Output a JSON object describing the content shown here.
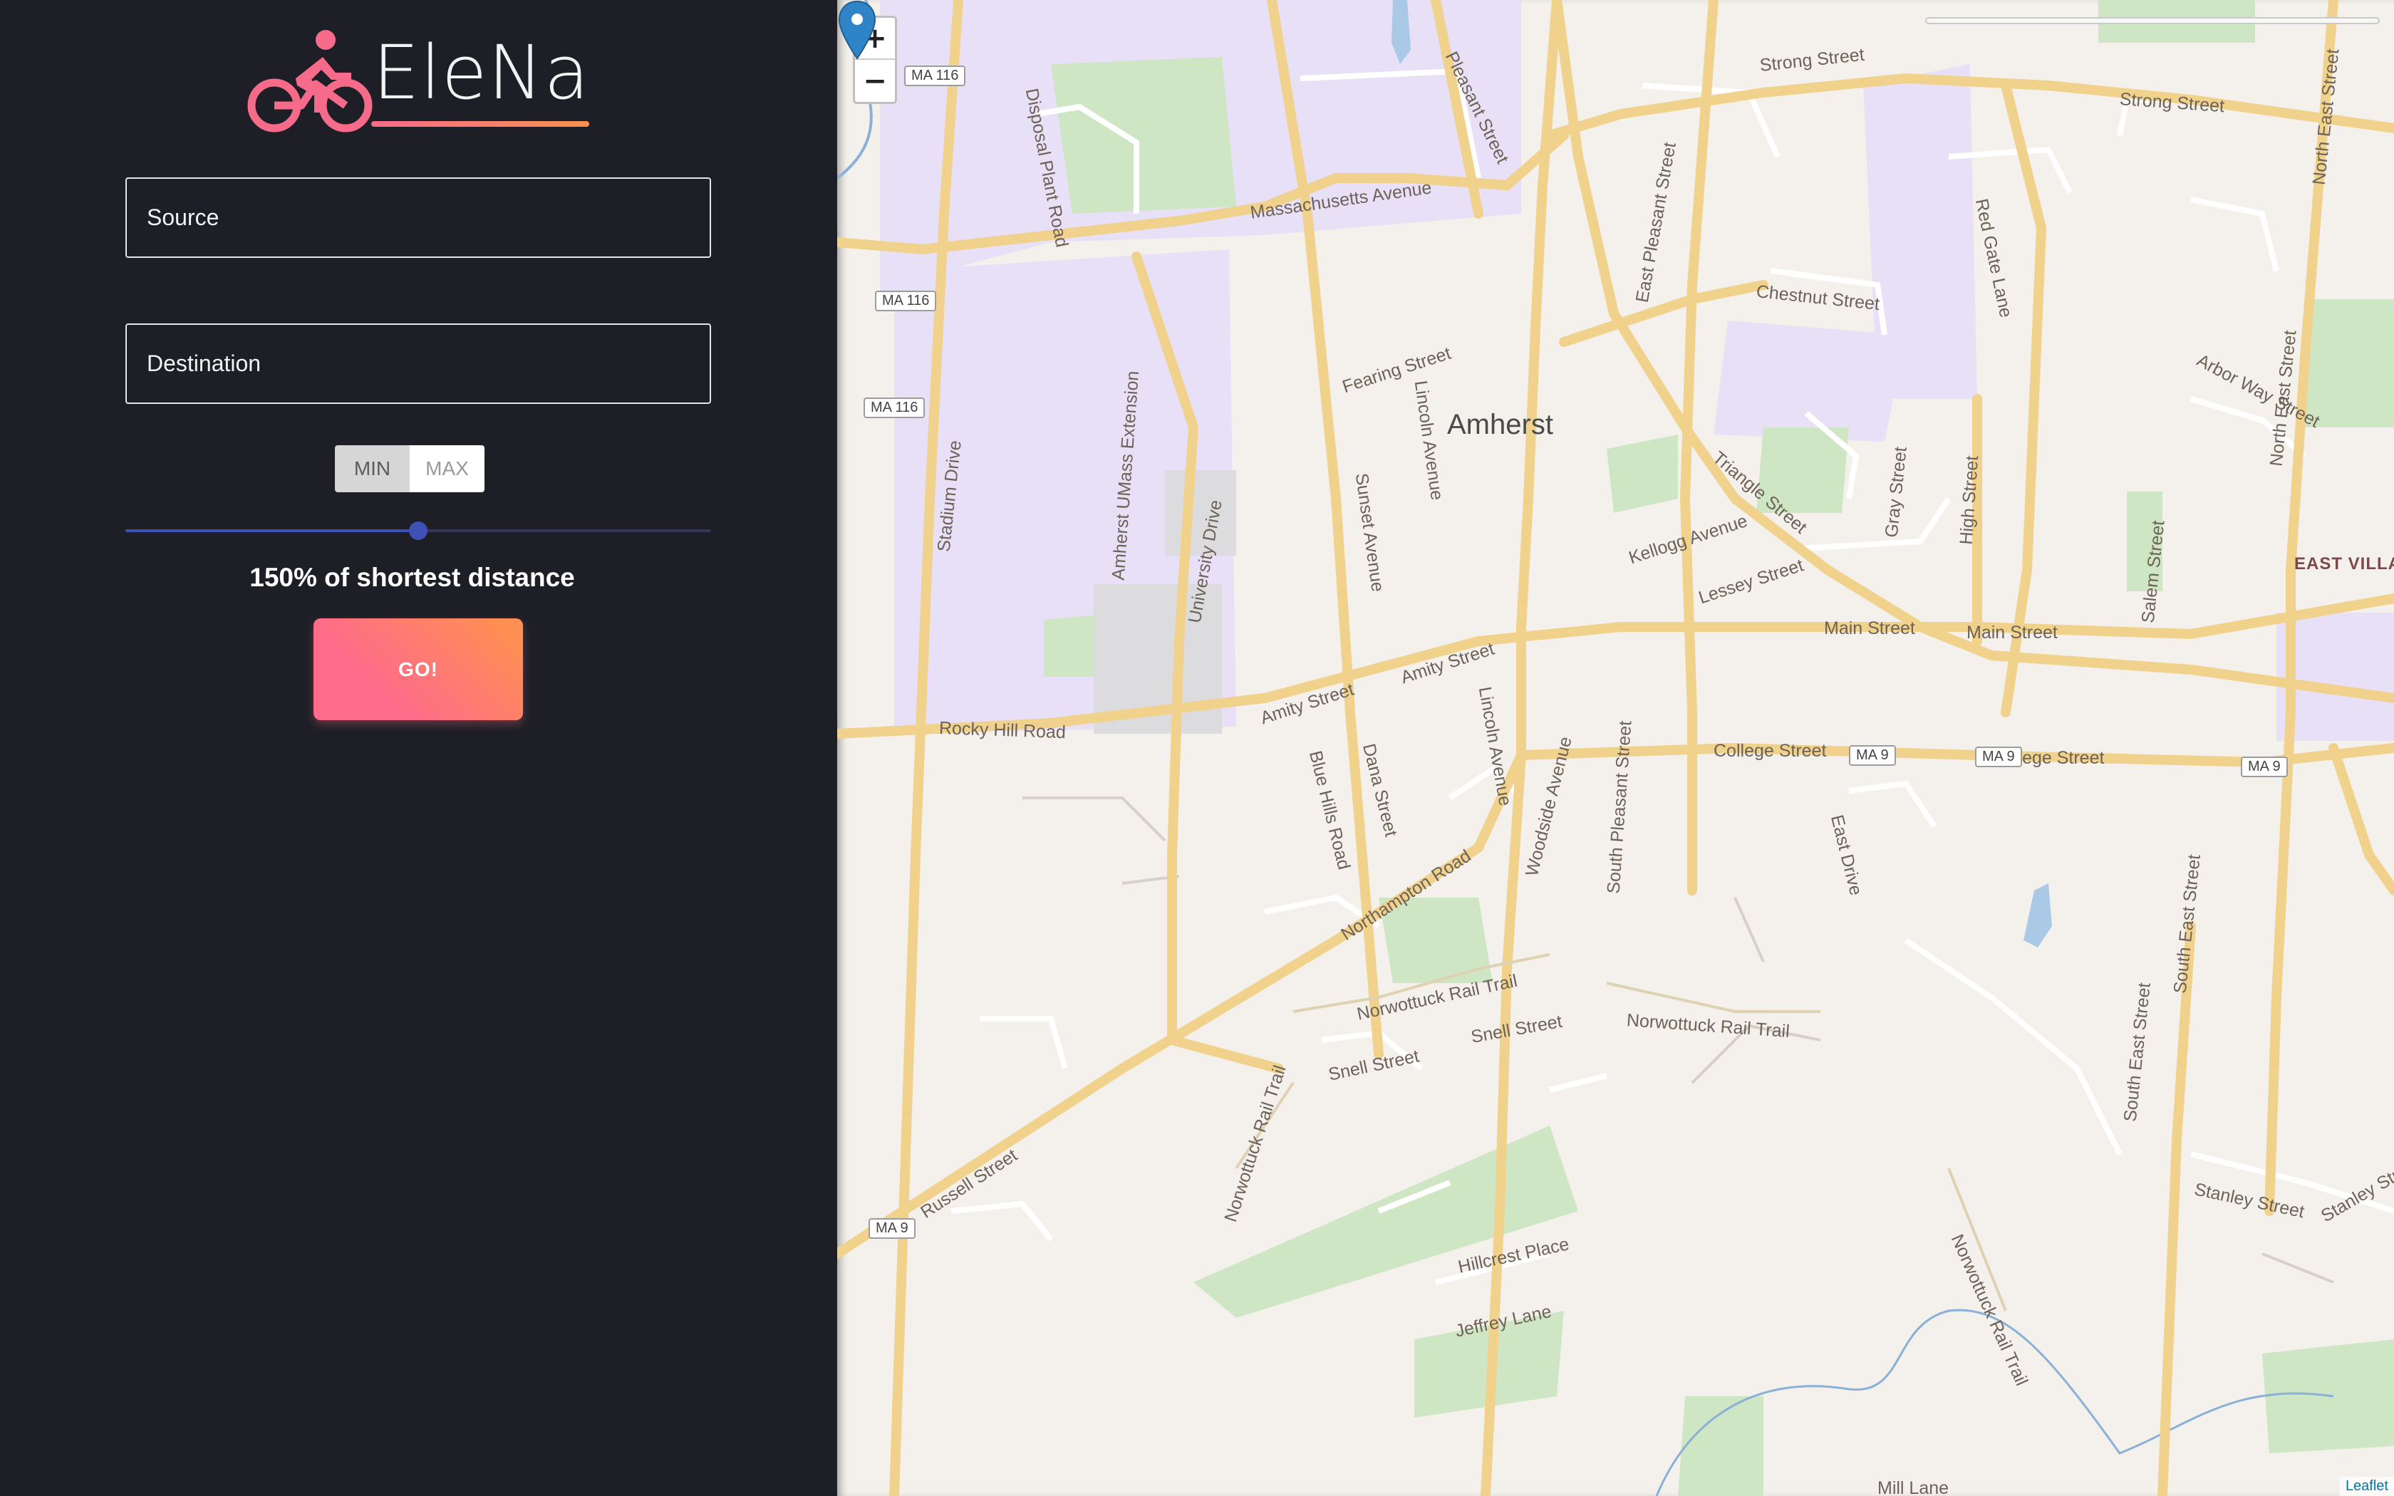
{
  "app": {
    "name": "EleNa",
    "logo_icon": "bicycle-rider-icon",
    "accent_gradient": [
      "#f76b8a",
      "#f9914f"
    ]
  },
  "form": {
    "source_placeholder": "Source",
    "destination_placeholder": "Destination",
    "mode_options": [
      "MIN",
      "MAX"
    ],
    "mode_selected": "MIN",
    "slider_percent": 50,
    "distance_label": "150% of shortest distance",
    "go_label": "GO!"
  },
  "map": {
    "zoom_in_label": "+",
    "zoom_out_label": "−",
    "attribution": "Leaflet",
    "marker_icon": "map-pin-icon",
    "town": "Amherst",
    "region": "EAST VILLA",
    "streets": [
      "Strong Street",
      "Strong Street",
      "Massachusetts Avenue",
      "Chestnut Street",
      "Fearing Street",
      "East Pleasant Street",
      "Disposal Plant Road",
      "Stadium Drive",
      "Amherst UMass Extension",
      "University Drive",
      "Sunset Avenue",
      "Lincoln Avenue",
      "Triangle Street",
      "Kellogg Avenue",
      "Lessey Street",
      "Main Street",
      "Main Street",
      "Amity Street",
      "Amity Street",
      "Rocky Hill Road",
      "College Street",
      "College Street",
      "Blue Hills Road",
      "Dana Street",
      "Lincoln Avenue",
      "East Drive",
      "Woodside Avenue",
      "South Pleasant Street",
      "Northampton Road",
      "Norwottuck Rail Trail",
      "Norwottuck Rail Trail",
      "Snell Street",
      "Snell Street",
      "Norwottuck Rail Trail",
      "Russell Street",
      "Hillcrest Place",
      "Jeffrey Lane",
      "Norwottuck Rail Trail",
      "South East Street",
      "South East Street",
      "Stanley Street",
      "Stanley Street",
      "Red Gate Lane",
      "Gray Street",
      "High Street",
      "Salem Street",
      "North East Street",
      "North East Street",
      "Arbor Way Street",
      "Pleasant Street",
      "Mill Lane"
    ],
    "shields": [
      "MA 116",
      "MA 116",
      "MA 116",
      "MA 9",
      "MA 9",
      "MA 9",
      "MA 9"
    ]
  }
}
